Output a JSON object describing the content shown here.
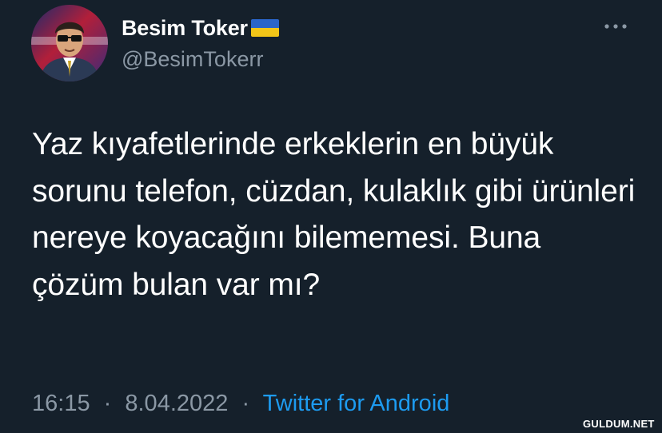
{
  "colors": {
    "background": "#15202b",
    "text_primary": "#ffffff",
    "text_secondary": "#8b98a5",
    "link": "#1d9bf0",
    "flag_blue": "#2a65c9",
    "flag_yellow": "#f2c518"
  },
  "author": {
    "display_name": "Besim Toker",
    "handle": "@BesimTokerr",
    "avatar_icon": "cartoon-avatar",
    "badge_icon": "ukraine-flag-icon"
  },
  "more_icon": "ellipsis-icon",
  "tweet": {
    "text": "Yaz kıyafetlerinde erkeklerin en büyük sorunu telefon, cüzdan, kulaklık gibi ürünleri nereye koyacağını bilememesi. Buna çözüm bulan var mı?",
    "time": "16:15",
    "separator": "·",
    "date": "8.04.2022",
    "source": "Twitter for Android"
  },
  "watermark": "GULDUM.NET"
}
